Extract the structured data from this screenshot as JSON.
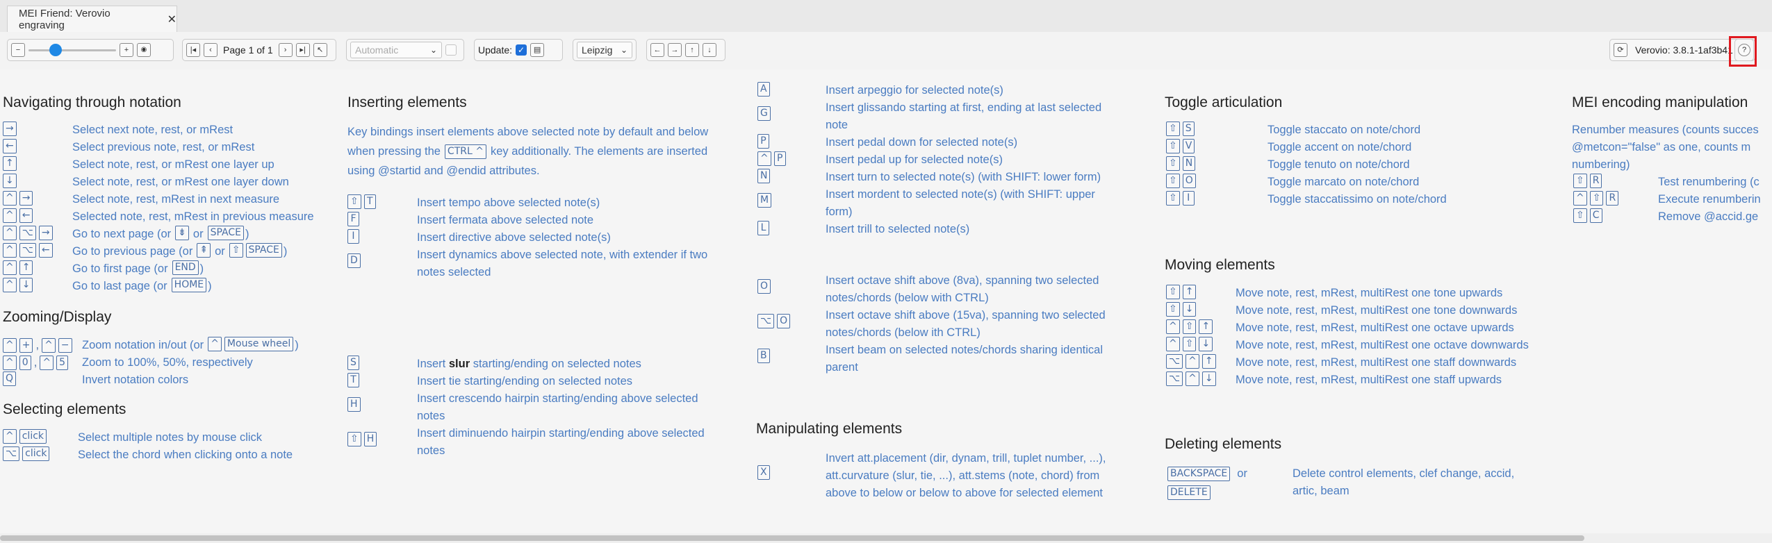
{
  "tab": {
    "title": "MEI Friend: Verovio engraving",
    "close": "✕"
  },
  "toolbar": {
    "zoom_out": "−",
    "zoom_in": "+",
    "eye": "👁",
    "page_first": "⏮",
    "page_prev": "‹",
    "page_label": "Page 1 of 1",
    "page_next": "›",
    "page_last": "⏭",
    "page_flip": "↖",
    "breaks_value": "Automatic",
    "update_label": "Update:",
    "update_checked": "✓",
    "font_value": "Leipzig",
    "nav_left": "←",
    "nav_right": "→",
    "nav_up": "↑",
    "nav_down": "↓",
    "refresh": "⟳",
    "version": "Verovio: 3.8.1-1af3b41",
    "help": "?"
  },
  "nav": {
    "heading": "Navigating through notation",
    "rows": [
      {
        "keys": [
          "→"
        ],
        "desc": "Select next note, rest, or mRest"
      },
      {
        "keys": [
          "←"
        ],
        "desc": "Select previous note, rest, or mRest"
      },
      {
        "keys": [
          "↑"
        ],
        "desc": "Select note, rest, or mRest one layer up"
      },
      {
        "keys": [
          "↓"
        ],
        "desc": "Select note, rest, or mRest one layer down"
      },
      {
        "keys": [
          "^",
          "→"
        ],
        "desc": "Select note, rest, mRest in next measure"
      },
      {
        "keys": [
          "^",
          "←"
        ],
        "desc": "Selected note, rest, mRest in previous measure"
      },
      {
        "keys": [
          "^",
          "⌥",
          "→"
        ],
        "desc": "Go to next page (or",
        "k2": "⇟",
        "or": "or",
        "k3": "SPACE",
        "end": ")"
      },
      {
        "keys": [
          "^",
          "⌥",
          "←"
        ],
        "desc": "Go to previous page (or",
        "k2": "⇞",
        "or": "or",
        "k3a": "⇧",
        "k3": "SPACE",
        "end": ")"
      },
      {
        "keys": [
          "^",
          "↑"
        ],
        "desc": "Go to first page (or",
        "k3": "END",
        "end": ")"
      },
      {
        "keys": [
          "^",
          "↓"
        ],
        "desc": "Go to last page (or",
        "k3": "HOME",
        "end": ")"
      }
    ]
  },
  "zoom": {
    "heading": "Zooming/Display",
    "r1_desc": "Zoom notation in/out (or",
    "r1_k": "^",
    "r1_k2": "Mouse wheel",
    "r1_end": ")",
    "r2_desc": "Zoom to 100%, 50%, respectively",
    "r3_key": "Q",
    "r3_desc": "Invert notation colors",
    "plus": "+",
    "minus": "−",
    "zero": "0",
    "five": "5",
    "comma": ",",
    "ctrl": "^"
  },
  "select": {
    "heading": "Selecting elements",
    "rows": [
      {
        "keys": [
          "^",
          "click"
        ],
        "desc": "Select multiple notes by mouse click"
      },
      {
        "keys": [
          "⌥",
          "click"
        ],
        "desc": "Select the chord when clicking onto a note"
      }
    ]
  },
  "insert": {
    "heading": "Inserting elements",
    "para1": "Key bindings insert elements above selected note by default and below",
    "para2a": "when pressing the",
    "para2k": "CTRL ^",
    "para2b": "key additionally. The elements are inserted",
    "para3": "using @startid and @endid attributes.",
    "rows": [
      {
        "keys": [
          "⇧",
          "T"
        ],
        "desc": "Insert tempo above selected note(s)"
      },
      {
        "keys": [
          "F"
        ],
        "desc": "Insert fermata above selected note"
      },
      {
        "keys": [
          "I"
        ],
        "desc": "Insert directive above selected note(s)"
      },
      {
        "keys": [
          "D"
        ],
        "desc": "Insert dynamics above selected note, with extender if two",
        "desc2": "notes selected"
      }
    ],
    "rows2": [
      {
        "keys": [
          "S"
        ],
        "pre": "Insert ",
        "bold": "slur",
        "desc": " starting/ending on selected notes"
      },
      {
        "keys": [
          "T"
        ],
        "desc": "Insert tie starting/ending on selected notes"
      },
      {
        "keys": [
          "H"
        ],
        "desc": "Insert crescendo hairpin starting/ending above selected",
        "desc2": "notes"
      },
      {
        "keys": [
          "⇧",
          "H"
        ],
        "desc": "Insert diminuendo hairpin starting/ending above selected",
        "desc2": "notes"
      }
    ]
  },
  "insert2": {
    "rows": [
      {
        "keys": [
          "A"
        ],
        "desc": "Insert arpeggio for selected note(s)"
      },
      {
        "keys": [
          "G"
        ],
        "desc": "Insert glissando starting at first, ending at last selected",
        "desc2": "note"
      },
      {
        "keys": [
          "P"
        ],
        "desc": "Insert pedal down for selected note(s)"
      },
      {
        "keys": [
          "^",
          "P"
        ],
        "desc": "Insert pedal up for selected note(s)"
      },
      {
        "keys": [
          "N"
        ],
        "desc": "Insert turn to selected note(s) (with SHIFT: lower form)"
      },
      {
        "keys": [
          "M"
        ],
        "desc": "Insert mordent to selected note(s) (with SHIFT: upper",
        "desc2": "form)"
      },
      {
        "keys": [
          "L"
        ],
        "desc": "Insert trill to selected note(s)"
      }
    ],
    "rows2": [
      {
        "keys": [
          "O"
        ],
        "desc": "Insert octave shift above (8va), spanning two selected",
        "desc2": "notes/chords (below with CTRL)"
      },
      {
        "keys": [
          "⌥",
          "O"
        ],
        "desc": "Insert octave shift above (15va), spanning two selected",
        "desc2": "notes/chords (below ith CTRL)"
      },
      {
        "keys": [
          "B"
        ],
        "desc": "Insert beam on selected notes/chords sharing identical",
        "desc2": "parent"
      }
    ]
  },
  "manip": {
    "heading": "Manipulating elements",
    "key": "X",
    "l1": "Invert att.placement (dir, dynam, trill, tuplet number, ...),",
    "l2": "att.curvature (slur, tie, ...), att.stems (note, chord) from",
    "l3": "above to below or below to above for selected element"
  },
  "toggle": {
    "heading": "Toggle articulation",
    "rows": [
      {
        "keys": [
          "⇧",
          "S"
        ],
        "desc": "Toggle staccato on note/chord"
      },
      {
        "keys": [
          "⇧",
          "V"
        ],
        "desc": "Toggle accent on note/chord"
      },
      {
        "keys": [
          "⇧",
          "N"
        ],
        "desc": "Toggle tenuto on note/chord"
      },
      {
        "keys": [
          "⇧",
          "O"
        ],
        "desc": "Toggle marcato on note/chord"
      },
      {
        "keys": [
          "⇧",
          "I"
        ],
        "desc": "Toggle staccatissimo on note/chord"
      }
    ]
  },
  "moving": {
    "heading": "Moving elements",
    "rows": [
      {
        "keys": [
          "⇧",
          "↑"
        ],
        "desc": "Move note, rest, mRest, multiRest one tone upwards"
      },
      {
        "keys": [
          "⇧",
          "↓"
        ],
        "desc": "Move note, rest, mRest, multiRest one tone downwards"
      },
      {
        "keys": [
          "^",
          "⇧",
          "↑"
        ],
        "desc": "Move note, rest, mRest, multiRest one octave upwards"
      },
      {
        "keys": [
          "^",
          "⇧",
          "↓"
        ],
        "desc": "Move note, rest, mRest, multiRest one octave downwards"
      },
      {
        "keys": [
          "⌥",
          "^",
          "↑"
        ],
        "desc": "Move note, rest, mRest, multiRest one staff downwards"
      },
      {
        "keys": [
          "⌥",
          "^",
          "↓"
        ],
        "desc": "Move note, rest, mRest, multiRest one staff upwards"
      }
    ]
  },
  "deleting": {
    "heading": "Deleting elements",
    "k1": "BACKSPACE",
    "or": "or",
    "k2": "DELETE",
    "d1": "Delete control elements, clef change, accid,",
    "d2": "artic, beam"
  },
  "mei": {
    "heading": "MEI encoding manipulation",
    "p1": "Renumber measures (counts succes",
    "p2": "@metcon=\"false\" as one, counts m",
    "p3": "numbering)",
    "rows": [
      {
        "keys": [
          "⇧",
          "R"
        ],
        "desc": "Test renumbering (c"
      },
      {
        "keys": [
          "^",
          "⇧",
          "R"
        ],
        "desc": "Execute renumberin"
      },
      {
        "keys": [
          "⇧",
          "C"
        ],
        "desc": "Remove @accid.ge"
      }
    ]
  }
}
